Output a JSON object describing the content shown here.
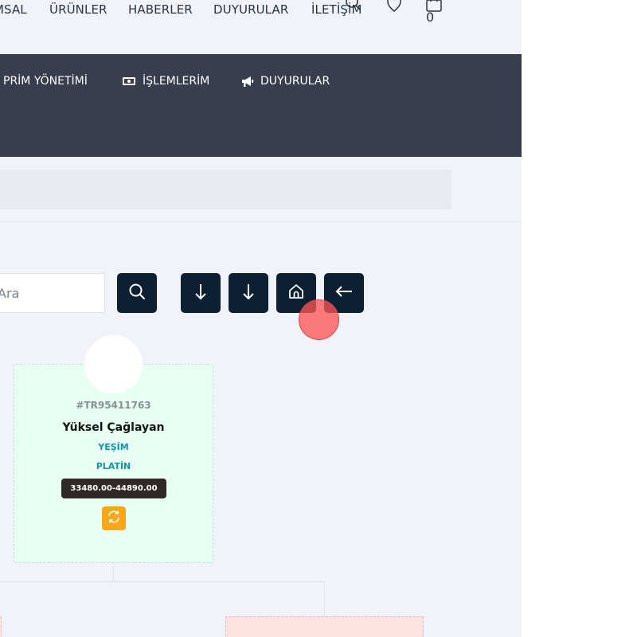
{
  "topnav": {
    "items": [
      "MSAL",
      "ÜRÜNLER",
      "HABERLER",
      "DUYURULAR",
      "İLETİŞİM"
    ],
    "icons": [
      "search-icon",
      "heart-icon",
      "shopping-bag-icon"
    ],
    "cart_count": "0"
  },
  "menu": {
    "items": [
      {
        "label": "PRİM YÖNETİMİ",
        "icon": "none"
      },
      {
        "label": "İŞLEMLERİM",
        "icon": "money-icon"
      },
      {
        "label": "DUYURULAR",
        "icon": "megaphone-icon"
      }
    ]
  },
  "toolbar": {
    "search_placeholder": "Ara",
    "buttons": [
      "search-icon",
      "arrow-down-icon",
      "arrow-down-icon",
      "home-icon",
      "arrow-left-icon"
    ]
  },
  "member": {
    "id": "#TR95411763",
    "name": "Yüksel Çağlayan",
    "tag1": "YEŞİM",
    "tag2": "PLATİN",
    "range": "33480.00-44890.00"
  },
  "colors": {
    "page_bg": "#f0f3f9",
    "dark_bar": "#393e4f",
    "button_bg": "#0d1f33",
    "card_bg": "#e8fff4",
    "tag_color": "#1592a8",
    "refresh_bg": "#f6a81b",
    "child_card_bg": "#fde2e2"
  }
}
